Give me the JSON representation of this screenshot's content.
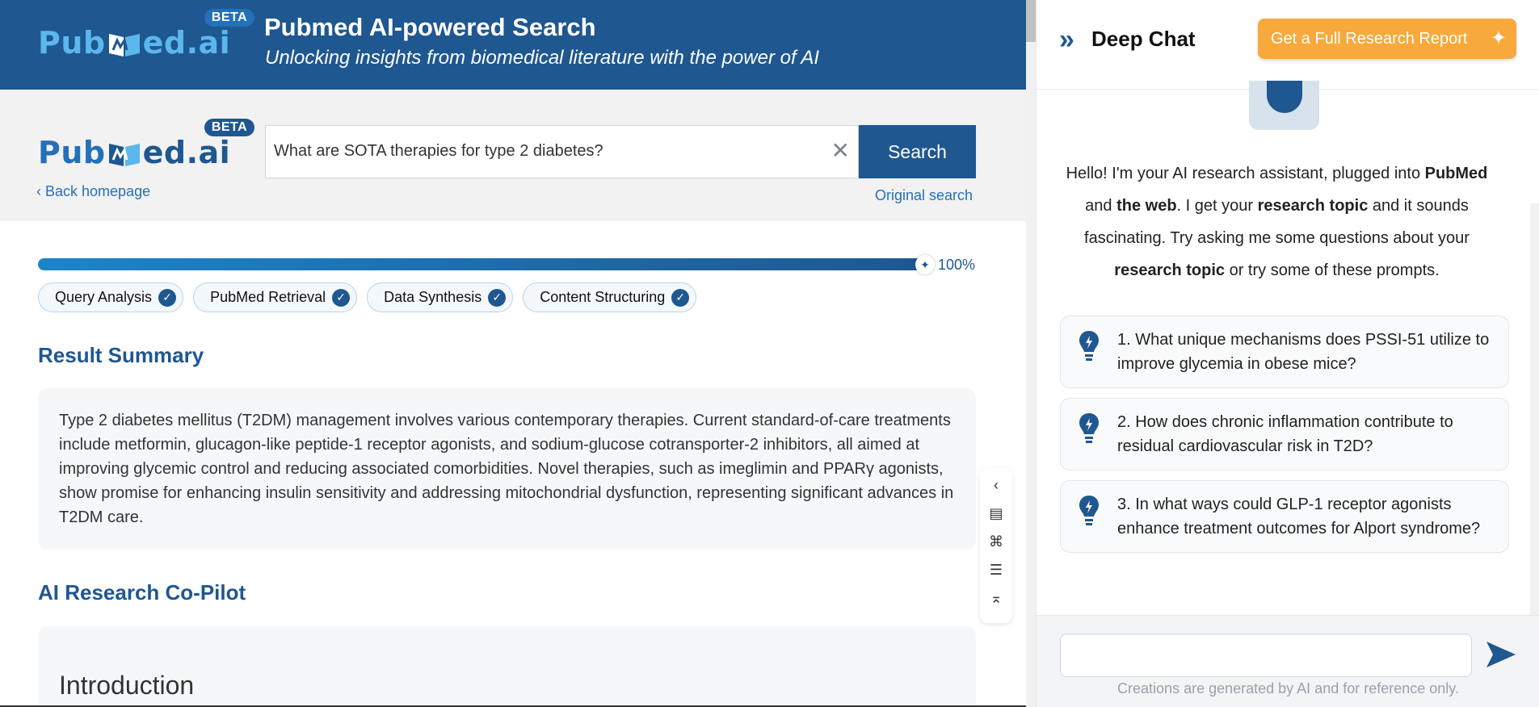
{
  "header": {
    "logo_text_left": "Pub",
    "logo_text_right": "ed.ai",
    "beta": "BETA",
    "title": "Pubmed AI-powered Search",
    "subtitle": "Unlocking insights from biomedical literature with the power of AI"
  },
  "search": {
    "logo_text_left": "Pub",
    "logo_text_right": "ed.ai",
    "beta": "BETA",
    "query": "What are SOTA therapies for type 2 diabetes?",
    "clear": "✕",
    "button": "Search",
    "back": "Back homepage",
    "original": "Original search"
  },
  "progress": {
    "value": 1.0,
    "label": "100%"
  },
  "steps": [
    {
      "label": "Query Analysis"
    },
    {
      "label": "PubMed Retrieval"
    },
    {
      "label": "Data Synthesis"
    },
    {
      "label": "Content Structuring"
    }
  ],
  "result": {
    "heading": "Result Summary",
    "text": "Type 2 diabetes mellitus (T2DM) management involves various contemporary therapies. Current standard-of-care treatments include metformin, glucagon-like peptide-1 receptor agonists, and sodium-glucose cotransporter-2 inhibitors, all aimed at improving glycemic control and reducing associated comorbidities. Novel therapies, such as imeglimin and PPARγ agonists, show promise for enhancing insulin sensitivity and addressing mitochondrial dysfunction, representing significant advances in T2DM care."
  },
  "copilot": {
    "heading": "AI Research Co-Pilot",
    "intro": "Introduction"
  },
  "chat": {
    "title": "Deep Chat",
    "report_button": "Get a Full Research Report",
    "greeting": {
      "p1": "Hello! I'm your AI research assistant, plugged into ",
      "b1": "PubMed",
      "p2": " and ",
      "b2": "the web",
      "p3": ". I get your ",
      "b3": "research topic",
      "p4": " and it sounds fascinating. Try asking me some questions about your ",
      "b4": "research topic",
      "p5": " or try some of these prompts."
    },
    "prompts": [
      "1. What unique mechanisms does PSSI-51 utilize to improve glycemia in obese mice?",
      "2. How does chronic inflammation contribute to residual cardiovascular risk in T2D?",
      "3. In what ways could GLP-1 receptor agonists enhance treatment outcomes for Alport syndrome?"
    ],
    "input_placeholder": "",
    "disclaimer": "Creations are generated by AI and for reference only."
  },
  "colors": {
    "brand": "#1f5790",
    "accent_orange": "#f7a93b",
    "link": "#2470b9"
  },
  "icons": {
    "collapse": "chevron-left-icon",
    "doc": "document-icon",
    "dna": "dna-icon",
    "menu": "list-icon",
    "top": "back-to-top-icon"
  }
}
